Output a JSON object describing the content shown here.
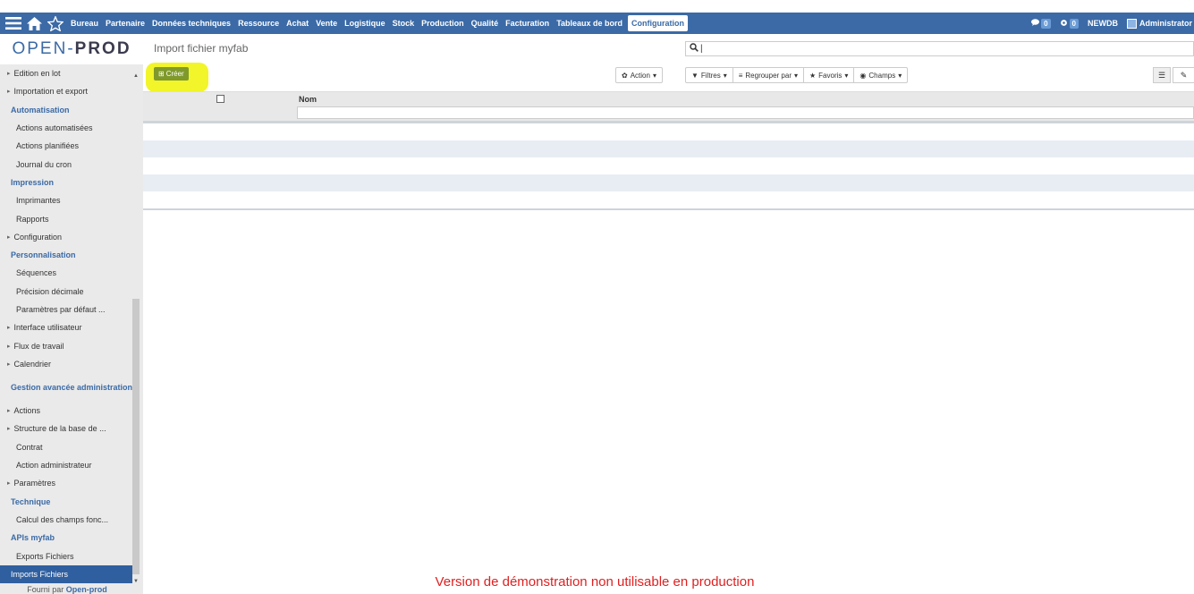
{
  "topbar": {
    "menu": [
      "Bureau",
      "Partenaire",
      "Données techniques",
      "Ressource",
      "Achat",
      "Vente",
      "Logistique",
      "Stock",
      "Production",
      "Qualité",
      "Facturation",
      "Tableaux de bord",
      "Configuration"
    ],
    "active_menu": "Configuration",
    "messages_count": "0",
    "activities_count": "0",
    "database": "NEWDB",
    "user": "Administrator"
  },
  "logo": {
    "open": "OPEN",
    "dash": "-",
    "prod": "PROD"
  },
  "sidebar": {
    "items": [
      {
        "type": "grp",
        "label": "Edition en lot"
      },
      {
        "type": "grp",
        "label": "Importation et export"
      },
      {
        "type": "head",
        "label": "Automatisation"
      },
      {
        "type": "sub",
        "label": "Actions automatisées"
      },
      {
        "type": "sub",
        "label": "Actions planifiées"
      },
      {
        "type": "sub",
        "label": "Journal du cron"
      },
      {
        "type": "head",
        "label": "Impression"
      },
      {
        "type": "sub",
        "label": "Imprimantes"
      },
      {
        "type": "sub",
        "label": "Rapports"
      },
      {
        "type": "grp",
        "label": "Configuration"
      },
      {
        "type": "head",
        "label": "Personnalisation"
      },
      {
        "type": "sub",
        "label": "Séquences"
      },
      {
        "type": "sub",
        "label": "Précision décimale"
      },
      {
        "type": "sub",
        "label": "Paramètres par défaut ..."
      },
      {
        "type": "grp",
        "label": "Interface utilisateur"
      },
      {
        "type": "grp",
        "label": "Flux de travail"
      },
      {
        "type": "grp",
        "label": "Calendrier"
      },
      {
        "type": "head2",
        "label": "Gestion avancée administration"
      },
      {
        "type": "grp",
        "label": "Actions"
      },
      {
        "type": "grp",
        "label": "Structure de la base de ..."
      },
      {
        "type": "sub",
        "label": "Contrat"
      },
      {
        "type": "sub",
        "label": "Action administrateur"
      },
      {
        "type": "grp",
        "label": "Paramètres"
      },
      {
        "type": "head",
        "label": "Technique"
      },
      {
        "type": "sub",
        "label": "Calcul des champs fonc..."
      },
      {
        "type": "head",
        "label": "APIs myfab"
      },
      {
        "type": "sub",
        "label": "Exports Fichiers"
      },
      {
        "type": "active",
        "label": "Imports Fichiers"
      }
    ],
    "footer_prefix": "Fourni par",
    "footer_link": "Open-prod"
  },
  "main": {
    "title": "Import fichier myfab",
    "search_value": "|",
    "create_label": "Créer",
    "action_label": "Action",
    "filters": [
      "Filtres",
      "Regrouper par",
      "Favoris",
      "Champs"
    ],
    "column_name": "Nom",
    "demo_notice": "Version de démonstration non utilisable en production"
  },
  "colors": {
    "topbar": "#3b6aa6",
    "highlight": "#e8f500",
    "create": "#7f9a2a",
    "demo": "#e02020"
  }
}
